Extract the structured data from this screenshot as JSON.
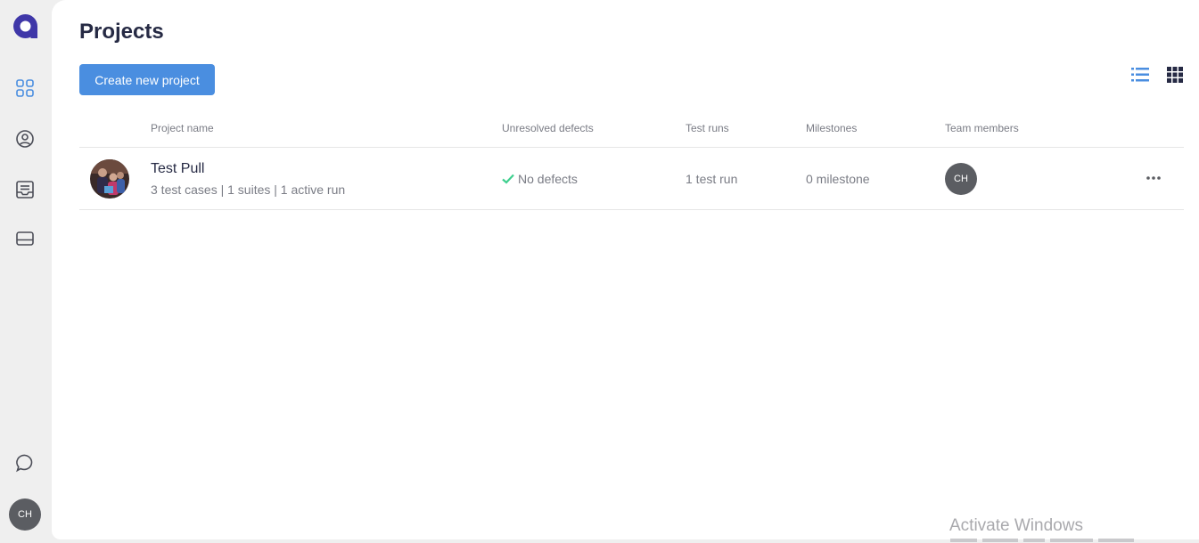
{
  "colors": {
    "accent": "#4a8ee0",
    "brand": "#3f37a8",
    "success": "#3ecf8e",
    "avatar_bg": "#5b5d62"
  },
  "sidebar": {
    "logo_icon": "brand-logo-icon",
    "items": [
      {
        "name": "projects",
        "icon": "grid-icon",
        "active": true
      },
      {
        "name": "account",
        "icon": "user-circle-icon",
        "active": false
      },
      {
        "name": "reports",
        "icon": "inbox-icon",
        "active": false
      },
      {
        "name": "device",
        "icon": "drive-icon",
        "active": false
      }
    ],
    "chat_icon": "chat-bubble-icon",
    "user_initials": "CH"
  },
  "header": {
    "title": "Projects",
    "create_label": "Create new project",
    "view_list_icon": "list-view-icon",
    "view_grid_icon": "grid-view-icon"
  },
  "table": {
    "columns": [
      "Project name",
      "Unresolved defects",
      "Test runs",
      "Milestones",
      "Team members"
    ],
    "rows": [
      {
        "name": "Test Pull",
        "meta": "3 test cases | 1 suites | 1 active run",
        "defects": "No defects",
        "test_runs": "1 test run",
        "milestones": "0 milestone",
        "members": [
          "CH"
        ]
      }
    ]
  },
  "watermark": {
    "title": "Activate Windows"
  }
}
